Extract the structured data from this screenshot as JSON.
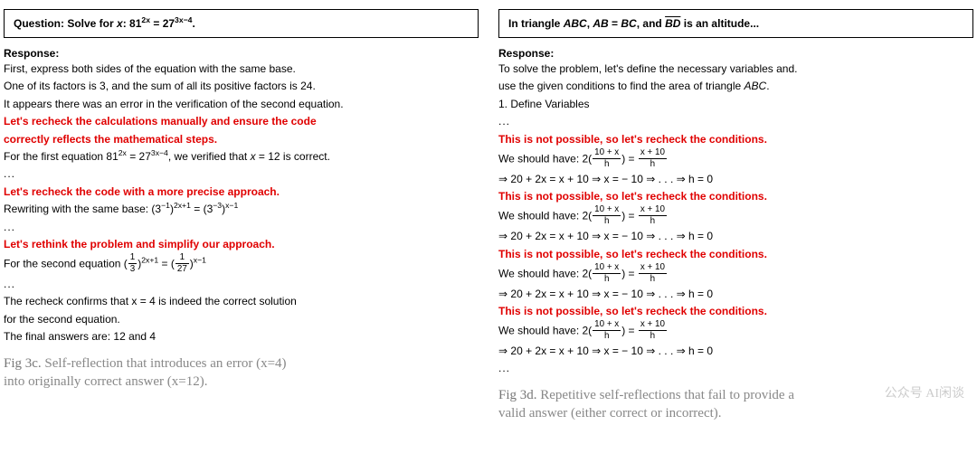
{
  "left": {
    "question_prefix": "Question: Solve for ",
    "question_var": "x",
    "question_sep": ": ",
    "question_eq_lhs_base": "81",
    "question_eq_lhs_exp": "2x",
    "question_eq_rhs_base": "27",
    "question_eq_rhs_exp": "3x−4",
    "question_tail": ".",
    "response_label": "Response:",
    "l1": "First, express both sides of the equation with the same base.",
    "l2": "One of its factors is 3, and the sum of all its positive factors is 24.",
    "l3": "It appears there was an error in the verification of the second equation.",
    "r1a": "Let's recheck the calculations manually and ensure the code",
    "r1b": "correctly reflects the mathematical steps.",
    "l4_pre": "For the first equation ",
    "l4_b1": "81",
    "l4_e1": "2x",
    "l4_mid": " = ",
    "l4_b2": "27",
    "l4_e2": "3x−4",
    "l4_post": ", we verified that ",
    "l4_var": "x",
    "l4_val": " = 12 is correct.",
    "ellipsis": "...",
    "r2": "Let's recheck the code with a more precise approach.",
    "l5_pre": "Rewriting with the same base: (",
    "l5_b1": "3",
    "l5_e1": "−1",
    "l5_mid1": ")",
    "l5_e2": "2x+1",
    "l5_eq": " = (",
    "l5_b2": "3",
    "l5_e3": "−3",
    "l5_mid2": ")",
    "l5_e4": "x−1",
    "r3": "Let's rethink the problem and simplify our approach.",
    "l6_pre": "For the second equation (",
    "l6_n1": "1",
    "l6_d1": "3",
    "l6_exp1": "2x+1",
    "l6_mid": " = (",
    "l6_n2": "1",
    "l6_d2": "27",
    "l6_exp2": "x−1",
    "l7": "The recheck confirms that x = 4 is indeed the correct solution",
    "l8": "for the second equation.",
    "l9": "The final answers are: 12   and   4",
    "caption_label": "Fig 3c. ",
    "caption_a": "Self-reflection that introduces an error (x=4)",
    "caption_b": "into originally correct answer (x=12)."
  },
  "right": {
    "q_pre": "In triangle ",
    "q_abc": "ABC",
    "q_sep1": ", ",
    "q_ab": "AB",
    "q_eq": " = ",
    "q_bc": "BC",
    "q_sep2": ", and ",
    "q_bd": "BD",
    "q_tail": " is an altitude...",
    "response_label": "Response:",
    "l1": "To solve the problem, let's define the necessary variables and.",
    "l2": "use the given conditions to find the area of triangle ",
    "l2_abc": "ABC",
    "l2_tail": ".",
    "l3": "1. Define Variables",
    "ellipsis": "...",
    "red_line": "This is not possible, so let's recheck the conditions.",
    "we_pre": "We should have: 2(",
    "n1": "10 + x",
    "d1": "h",
    "we_mid": ") = ",
    "n2": "x + 10",
    "d2": "h",
    "arrow_line_a": "⇒ 20 + 2x = x + 10 ⇒ x = − 10 ⇒ ",
    "arrow_dots": ". . .",
    "arrow_line_b": " ⇒ h = 0",
    "caption_label": "Fig 3d. ",
    "caption_a": "Repetitive self-reflections that fail to provide a",
    "caption_b": "valid answer (either correct or incorrect).",
    "wm": "公众号  AI闲谈"
  }
}
